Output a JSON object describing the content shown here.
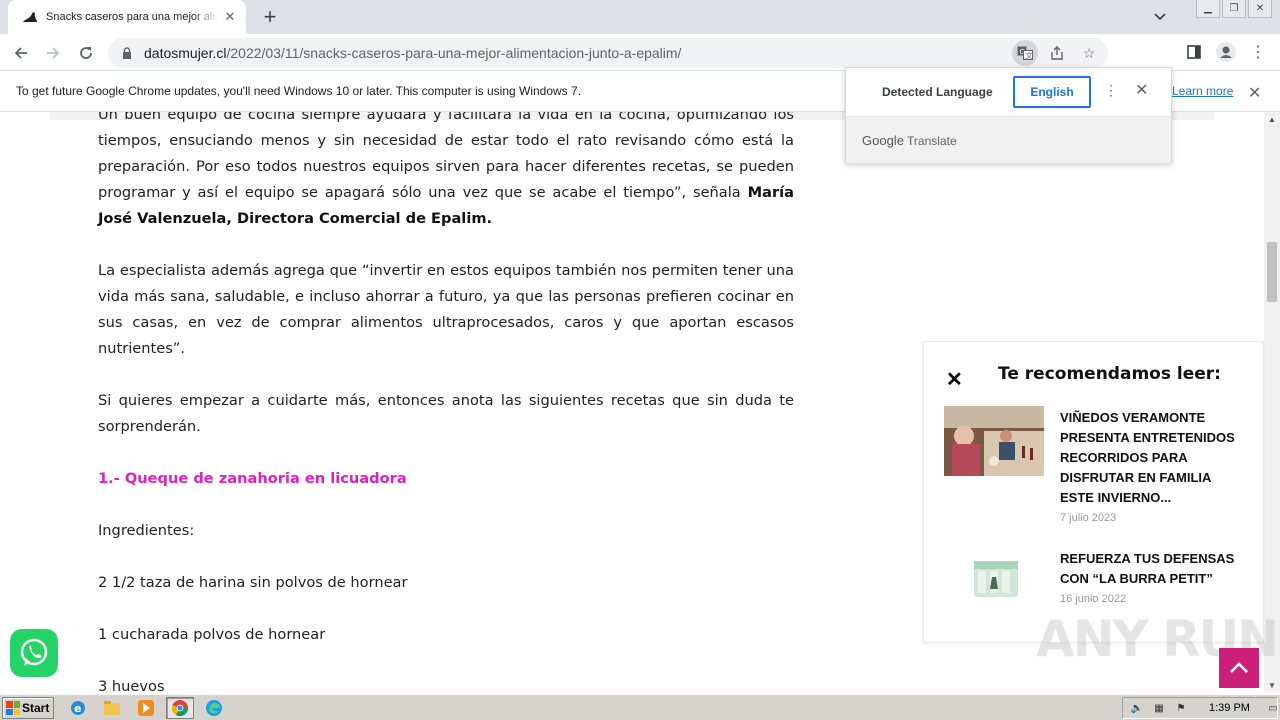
{
  "browser": {
    "tab_title": "Snacks caseros para una mejor alimentación",
    "new_tab_symbol": "+",
    "url_domain": "datosmujer.cl",
    "url_path": "/2022/03/11/snacks-caseros-para-una-mejor-alimentacion-junto-a-epalim/"
  },
  "infobar": {
    "message": "To get future Google Chrome updates, you'll need Windows 10 or later. This computer is using Windows 7.",
    "link": "Learn more"
  },
  "translate": {
    "detected_label": "Detected Language",
    "english_label": "English",
    "brand_google": "Google",
    "brand_translate": "Translate"
  },
  "article": {
    "p1_text": "Un buen equipo de cocina siempre ayudará y facilitará la vida en la cocina, optimizando los tiempos, ensuciando menos y sin necesidad de estar todo el rato revisando cómo está la preparación. Por eso todos nuestros equipos sirven para hacer diferentes recetas, se pueden programar y así el equipo se apagará sólo una vez que se acabe el tiempo”, señala ",
    "p1_bold": "María José Valenzuela, Directora Comercial de Epalim.",
    "p2": " La especialista además agrega que “invertir en estos equipos también nos permiten tener una vida más sana, saludable, e incluso ahorrar a futuro, ya que las personas prefieren cocinar en sus casas, en vez de comprar alimentos ultraprocesados, caros y que aportan escasos nutrientes”.",
    "p3": "Si quieres empezar a cuidarte más, entonces anota las siguientes recetas que sin duda te sorprenderán.",
    "heading": "1.- Queque de zanahoria en licuadora",
    "ingredients_label": "Ingredientes:",
    "ing1": "2 1/2 taza de harina sin polvos de hornear",
    "ing2": "1 cucharada polvos de hornear",
    "ing3": "3 huevos"
  },
  "recommend": {
    "title": "Te recomendamos leer:",
    "close_symbol": "✕",
    "items": [
      {
        "headline": "VIÑEDOS VERAMONTE PRESENTA ENTRETENIDOS RECORRIDOS PARA DISFRUTAR EN FAMILIA ESTE INVIERNO...",
        "date": "7 julio 2023"
      },
      {
        "headline": "REFUERZA TUS DEFENSAS CON “LA BURRA PETIT”",
        "date": "16 junio 2022"
      }
    ]
  },
  "watermark": "ANY RUN",
  "taskbar": {
    "start_label": "Start",
    "clock": "1:39 PM"
  }
}
